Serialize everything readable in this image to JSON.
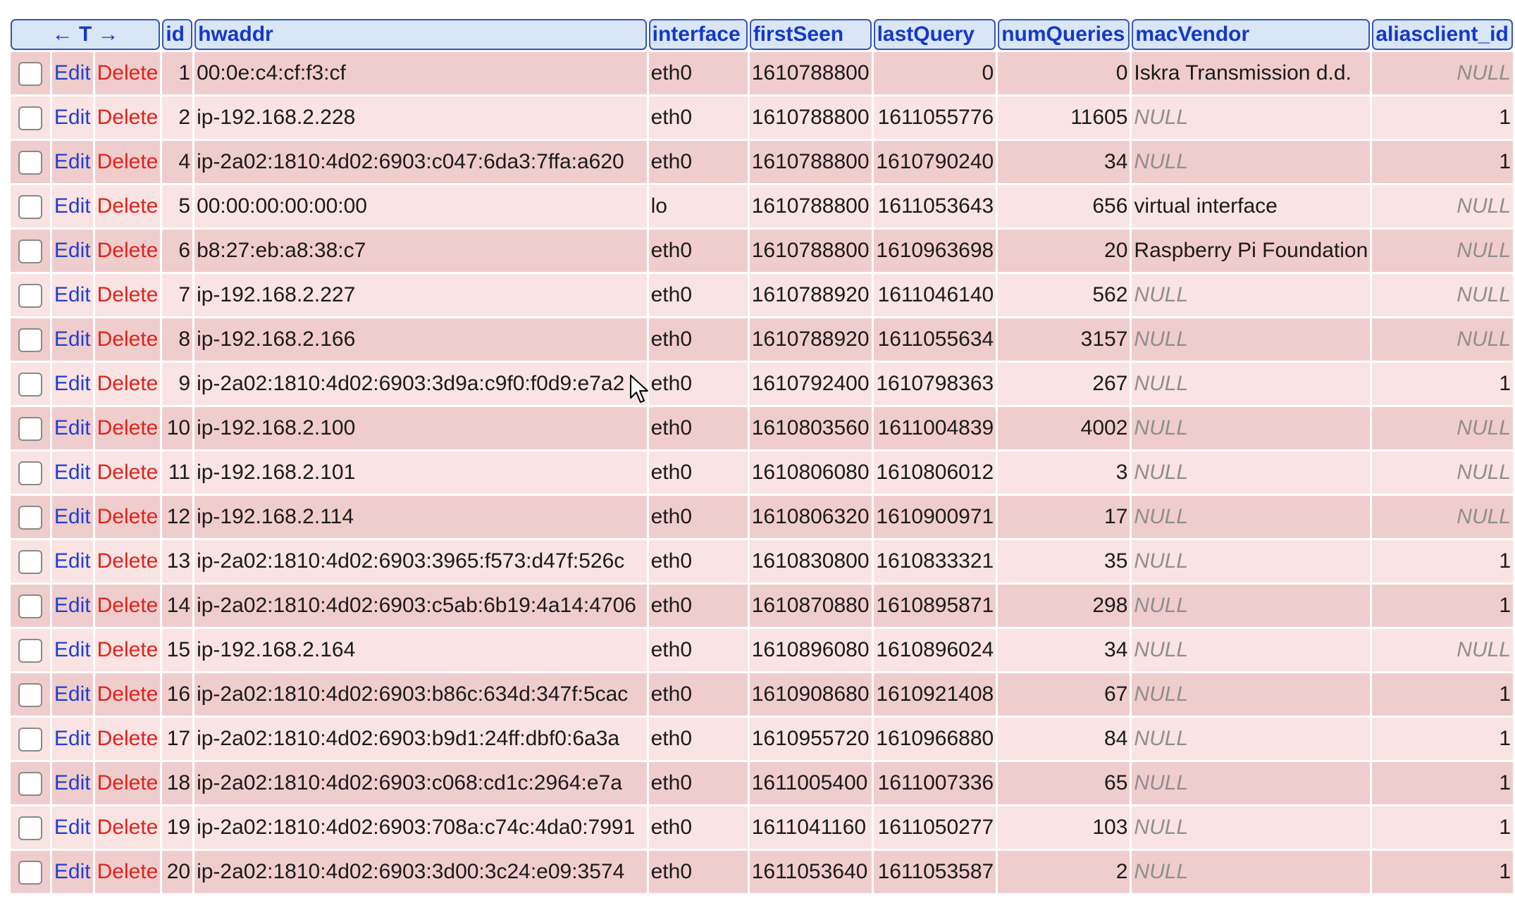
{
  "headers": {
    "nav_arrows": "← T →",
    "id": "id",
    "hwaddr": "hwaddr",
    "interface": "interface",
    "firstSeen": "firstSeen",
    "lastQuery": "lastQuery",
    "numQueries": "numQueries",
    "macVendor": "macVendor",
    "aliasclient_id": "aliasclient_id"
  },
  "actions": {
    "edit_label": "Edit",
    "delete_label": "Delete"
  },
  "rows": [
    {
      "id": "1",
      "hwaddr": "00:0e:c4:cf:f3:cf",
      "interface": "eth0",
      "firstSeen": "1610788800",
      "lastQuery": "0",
      "numQueries": "0",
      "macVendor": "Iskra Transmission d.d.",
      "aliasclient_id": "NULL"
    },
    {
      "id": "2",
      "hwaddr": "ip-192.168.2.228",
      "interface": "eth0",
      "firstSeen": "1610788800",
      "lastQuery": "1611055776",
      "numQueries": "11605",
      "macVendor": "NULL",
      "aliasclient_id": "1"
    },
    {
      "id": "4",
      "hwaddr": "ip-2a02:1810:4d02:6903:c047:6da3:7ffa:a620",
      "interface": "eth0",
      "firstSeen": "1610788800",
      "lastQuery": "1610790240",
      "numQueries": "34",
      "macVendor": "NULL",
      "aliasclient_id": "1"
    },
    {
      "id": "5",
      "hwaddr": "00:00:00:00:00:00",
      "interface": "lo",
      "firstSeen": "1610788800",
      "lastQuery": "1611053643",
      "numQueries": "656",
      "macVendor": "virtual interface",
      "aliasclient_id": "NULL"
    },
    {
      "id": "6",
      "hwaddr": "b8:27:eb:a8:38:c7",
      "interface": "eth0",
      "firstSeen": "1610788800",
      "lastQuery": "1610963698",
      "numQueries": "20",
      "macVendor": "Raspberry Pi Foundation",
      "aliasclient_id": "NULL"
    },
    {
      "id": "7",
      "hwaddr": "ip-192.168.2.227",
      "interface": "eth0",
      "firstSeen": "1610788920",
      "lastQuery": "1611046140",
      "numQueries": "562",
      "macVendor": "NULL",
      "aliasclient_id": "NULL"
    },
    {
      "id": "8",
      "hwaddr": "ip-192.168.2.166",
      "interface": "eth0",
      "firstSeen": "1610788920",
      "lastQuery": "1611055634",
      "numQueries": "3157",
      "macVendor": "NULL",
      "aliasclient_id": "NULL"
    },
    {
      "id": "9",
      "hwaddr": "ip-2a02:1810:4d02:6903:3d9a:c9f0:f0d9:e7a2",
      "interface": "eth0",
      "firstSeen": "1610792400",
      "lastQuery": "1610798363",
      "numQueries": "267",
      "macVendor": "NULL",
      "aliasclient_id": "1"
    },
    {
      "id": "10",
      "hwaddr": "ip-192.168.2.100",
      "interface": "eth0",
      "firstSeen": "1610803560",
      "lastQuery": "1611004839",
      "numQueries": "4002",
      "macVendor": "NULL",
      "aliasclient_id": "NULL"
    },
    {
      "id": "11",
      "hwaddr": "ip-192.168.2.101",
      "interface": "eth0",
      "firstSeen": "1610806080",
      "lastQuery": "1610806012",
      "numQueries": "3",
      "macVendor": "NULL",
      "aliasclient_id": "NULL"
    },
    {
      "id": "12",
      "hwaddr": "ip-192.168.2.114",
      "interface": "eth0",
      "firstSeen": "1610806320",
      "lastQuery": "1610900971",
      "numQueries": "17",
      "macVendor": "NULL",
      "aliasclient_id": "NULL"
    },
    {
      "id": "13",
      "hwaddr": "ip-2a02:1810:4d02:6903:3965:f573:d47f:526c",
      "interface": "eth0",
      "firstSeen": "1610830800",
      "lastQuery": "1610833321",
      "numQueries": "35",
      "macVendor": "NULL",
      "aliasclient_id": "1"
    },
    {
      "id": "14",
      "hwaddr": "ip-2a02:1810:4d02:6903:c5ab:6b19:4a14:4706",
      "interface": "eth0",
      "firstSeen": "1610870880",
      "lastQuery": "1610895871",
      "numQueries": "298",
      "macVendor": "NULL",
      "aliasclient_id": "1"
    },
    {
      "id": "15",
      "hwaddr": "ip-192.168.2.164",
      "interface": "eth0",
      "firstSeen": "1610896080",
      "lastQuery": "1610896024",
      "numQueries": "34",
      "macVendor": "NULL",
      "aliasclient_id": "NULL"
    },
    {
      "id": "16",
      "hwaddr": "ip-2a02:1810:4d02:6903:b86c:634d:347f:5cac",
      "interface": "eth0",
      "firstSeen": "1610908680",
      "lastQuery": "1610921408",
      "numQueries": "67",
      "macVendor": "NULL",
      "aliasclient_id": "1"
    },
    {
      "id": "17",
      "hwaddr": "ip-2a02:1810:4d02:6903:b9d1:24ff:dbf0:6a3a",
      "interface": "eth0",
      "firstSeen": "1610955720",
      "lastQuery": "1610966880",
      "numQueries": "84",
      "macVendor": "NULL",
      "aliasclient_id": "1"
    },
    {
      "id": "18",
      "hwaddr": "ip-2a02:1810:4d02:6903:c068:cd1c:2964:e7a",
      "interface": "eth0",
      "firstSeen": "1611005400",
      "lastQuery": "1611007336",
      "numQueries": "65",
      "macVendor": "NULL",
      "aliasclient_id": "1"
    },
    {
      "id": "19",
      "hwaddr": "ip-2a02:1810:4d02:6903:708a:c74c:4da0:7991",
      "interface": "eth0",
      "firstSeen": "1611041160",
      "lastQuery": "1611050277",
      "numQueries": "103",
      "macVendor": "NULL",
      "aliasclient_id": "1"
    },
    {
      "id": "20",
      "hwaddr": "ip-2a02:1810:4d02:6903:3d00:3c24:e09:3574",
      "interface": "eth0",
      "firstSeen": "1611053640",
      "lastQuery": "1611053587",
      "numQueries": "2",
      "macVendor": "NULL",
      "aliasclient_id": "1"
    }
  ],
  "colors": {
    "header_bg": "#d9e6f6",
    "header_border": "#3556b6",
    "header_text": "#1538c9",
    "row_odd": "#f0cdcd",
    "row_even": "#f9e3e3",
    "edit_link": "#1f3fd1",
    "delete_link": "#e0221c",
    "null_text": "#8e8e8e"
  }
}
